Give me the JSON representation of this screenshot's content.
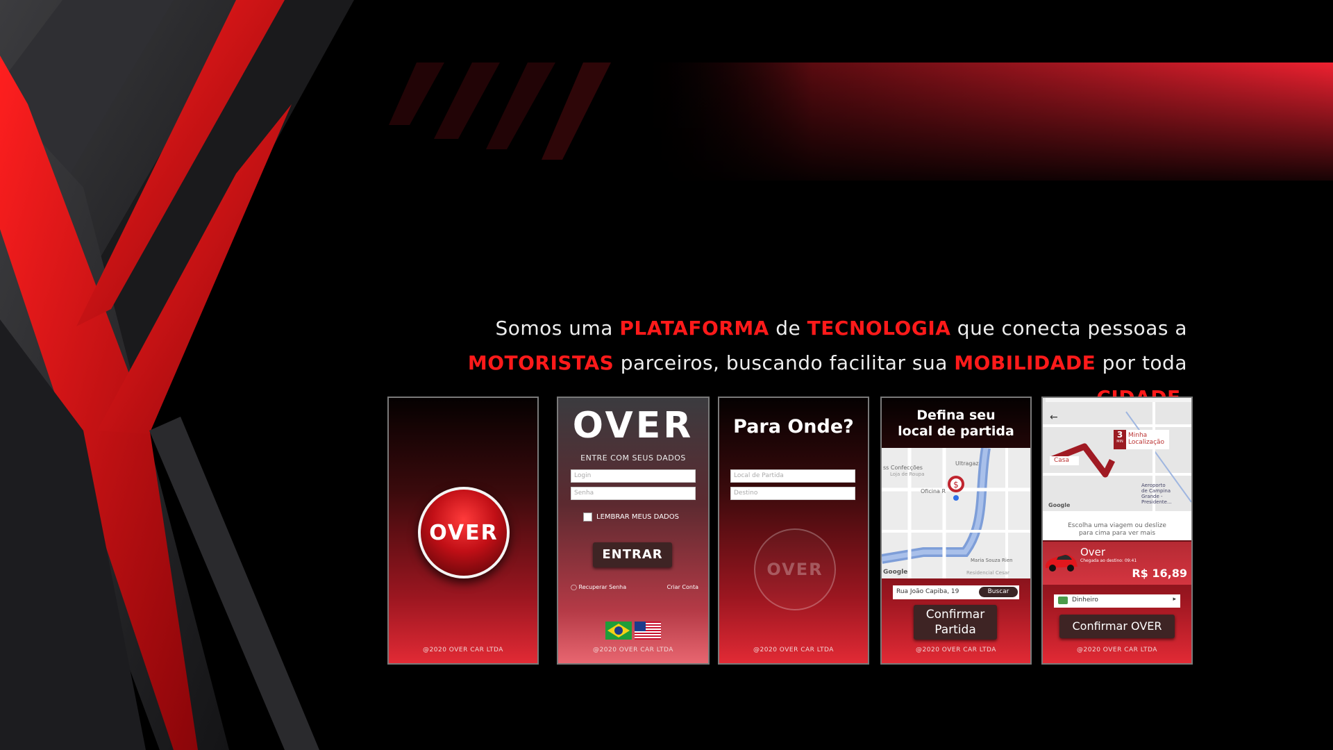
{
  "tagline": {
    "line1": [
      {
        "text": "Somos uma ",
        "hl": false
      },
      {
        "text": "PLATAFORMA",
        "hl": true
      },
      {
        "text": " de ",
        "hl": false
      },
      {
        "text": "TECNOLOGIA",
        "hl": true
      },
      {
        "text": " que conecta pessoas a",
        "hl": false
      }
    ],
    "line2": [
      {
        "text": "MOTORISTAS",
        "hl": true
      },
      {
        "text": " parceiros, buscando facilitar sua ",
        "hl": false
      },
      {
        "text": "MOBILIDADE",
        "hl": true
      },
      {
        "text": " por toda ",
        "hl": false
      },
      {
        "text": "CIDADE",
        "hl": true
      },
      {
        "text": ".",
        "hl": false
      }
    ]
  },
  "colors": {
    "accent": "#ff1a1a",
    "dark_button": "#3e2424",
    "background": "#000000"
  },
  "footer": "@2020 OVER CAR LTDA",
  "screen_splash": {
    "logo": "OVER"
  },
  "screen_login": {
    "brand": "OVER",
    "subtitle": "ENTRE COM SEUS DADOS",
    "login_placeholder": "Login",
    "password_placeholder": "Senha",
    "remember": "LEMBRAR MEUS DADOS",
    "enter_button": "ENTRAR",
    "recover": "Recuperar Senha",
    "create": "Criar Conta",
    "flags": [
      "brazil-flag-icon",
      "usa-flag-icon"
    ]
  },
  "screen_destination": {
    "title": "Para Onde?",
    "origin_placeholder": "Local de Partida",
    "destination_placeholder": "Destino",
    "logo": "OVER"
  },
  "screen_pickup": {
    "title_line1": "Defina seu",
    "title_line2": "local de partida",
    "map_labels": {
      "shop1": "ss Confecções",
      "shop2": "Loja de Roupa",
      "place1": "Ultragaz",
      "place2": "Oficina R",
      "place3": "Maria Souza Rien",
      "place4": "Residencial Cesar",
      "google": "Google"
    },
    "address": "Rua João Capiba, 19",
    "search_button": "Buscar",
    "confirm_line1": "Confirmar",
    "confirm_line2": "Partida"
  },
  "screen_ride": {
    "eta_number": "3",
    "eta_unit": "MIN",
    "my_location_line1": "Minha",
    "my_location_line2": "Localização",
    "home": "Casa",
    "airport_line1": "Aeroporto",
    "airport_line2": "de Campina",
    "airport_line3": "Grande -",
    "airport_line4": "Presidente...",
    "google": "Google",
    "hint_line1": "Escolha uma viagem ou deslize",
    "hint_line2": "para cima para ver mais",
    "ride_name": "Over",
    "ride_eta": "Chegada ao destino: 09:41",
    "price": "R$ 16,89",
    "payment": "Dinheiro",
    "confirm_button": "Confirmar OVER"
  }
}
